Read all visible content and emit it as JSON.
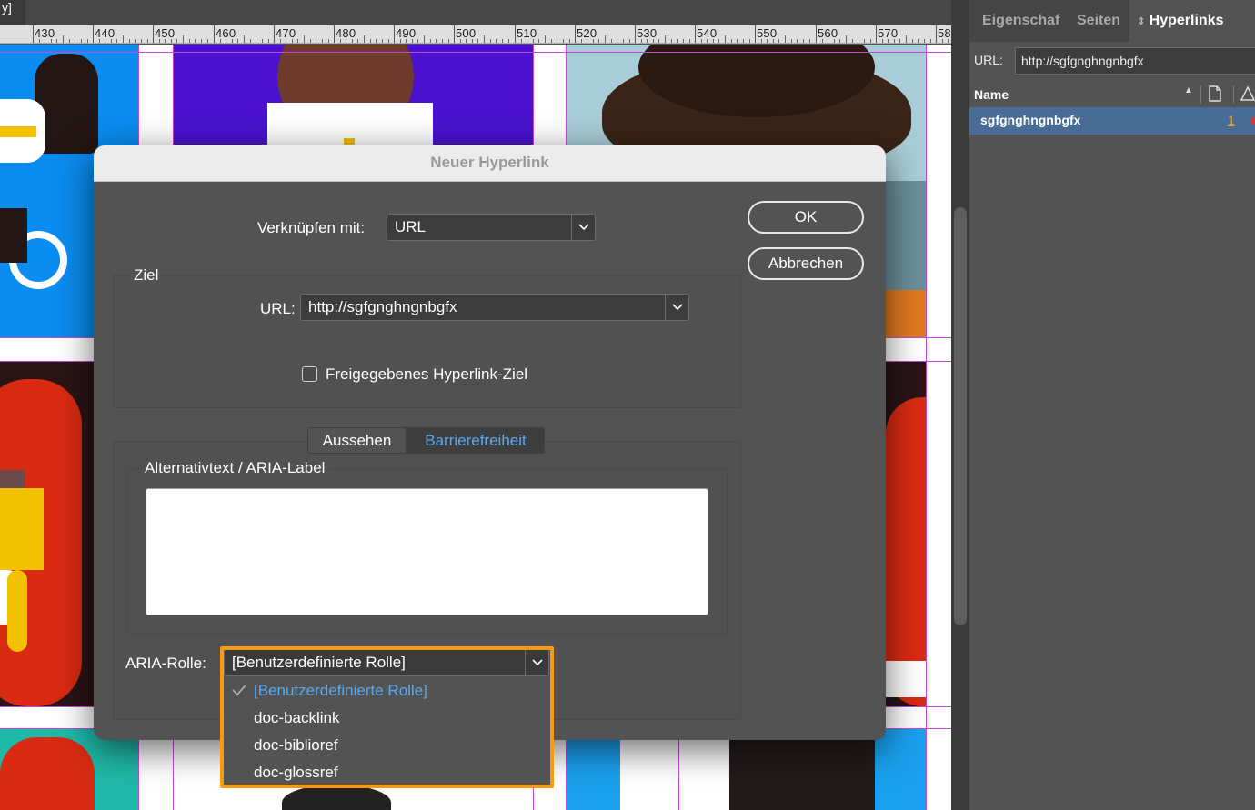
{
  "ruler": {
    "corner": "y]",
    "ticks": [
      "430",
      "440",
      "450",
      "460",
      "470",
      "480",
      "490",
      "500",
      "510",
      "520",
      "530",
      "540",
      "550",
      "560",
      "570",
      "58"
    ]
  },
  "panel": {
    "tabs": [
      {
        "label": "Eigenschaf"
      },
      {
        "label": "Seiten"
      },
      {
        "label": "Hyperlinks"
      }
    ],
    "url_label": "URL:",
    "url_value": "http://sgfgnghngnbgfx",
    "column_name": "Name",
    "rows": [
      {
        "name": "sgfgnghngnbgfx",
        "page": "1"
      }
    ]
  },
  "dialog": {
    "title": "Neuer Hyperlink",
    "link_with_label": "Verknüpfen mit:",
    "link_with_value": "URL",
    "ok_label": "OK",
    "cancel_label": "Abbrechen",
    "target_group_label": "Ziel",
    "url_label": "URL:",
    "url_value": "http://sgfgnghngnbgfx",
    "shared_checkbox_label": "Freigegebenes Hyperlink-Ziel",
    "shared_checked": false,
    "tabs": [
      {
        "label": "Aussehen",
        "active": false
      },
      {
        "label": "Barrierefreiheit",
        "active": true
      }
    ],
    "alt_text_label": "Alternativtext / ARIA-Label",
    "alt_text_value": "",
    "aria_role_label": "ARIA-Rolle:",
    "aria_role_value": "[Benutzerdefinierte Rolle]",
    "aria_role_options": [
      {
        "label": "[Benutzerdefinierte Rolle]",
        "selected": true
      },
      {
        "label": "doc-backlink",
        "selected": false
      },
      {
        "label": "doc-biblioref",
        "selected": false
      },
      {
        "label": "doc-glossref",
        "selected": false
      }
    ]
  },
  "colors": {
    "accent_blue": "#5aa8f0",
    "highlight_orange": "#f59a12",
    "selection_row": "#496c95"
  }
}
